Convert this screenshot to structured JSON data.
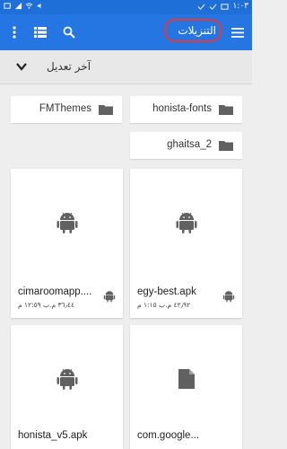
{
  "status_bar": {
    "time": "١:٠٣"
  },
  "app_bar": {
    "title": "التنزيلات"
  },
  "sort": {
    "label": "آخر تعديل"
  },
  "folders": [
    {
      "name": "honista-fonts"
    },
    {
      "name": "FMThemes"
    },
    {
      "name": "ghaitsa_2"
    }
  ],
  "files": [
    {
      "name": "egy-best.apk",
      "meta": "٤٢٫٩٢ م.ب ١:١٥ م",
      "type_icon": "android-icon"
    },
    {
      "name": "cimaroomapp....",
      "meta": "٣٦٫٤٤ م.ب ١٢:٥٩ م",
      "type_icon": "android-icon"
    },
    {
      "name": "com.google...",
      "meta": "",
      "type_icon": "document-icon"
    },
    {
      "name": "honista_v5.apk",
      "meta": "",
      "type_icon": "android-icon"
    }
  ],
  "colors": {
    "primary": "#2576e2",
    "status": "#1e6fd8",
    "highlight": "#e53935",
    "icon_gray": "#616161"
  }
}
